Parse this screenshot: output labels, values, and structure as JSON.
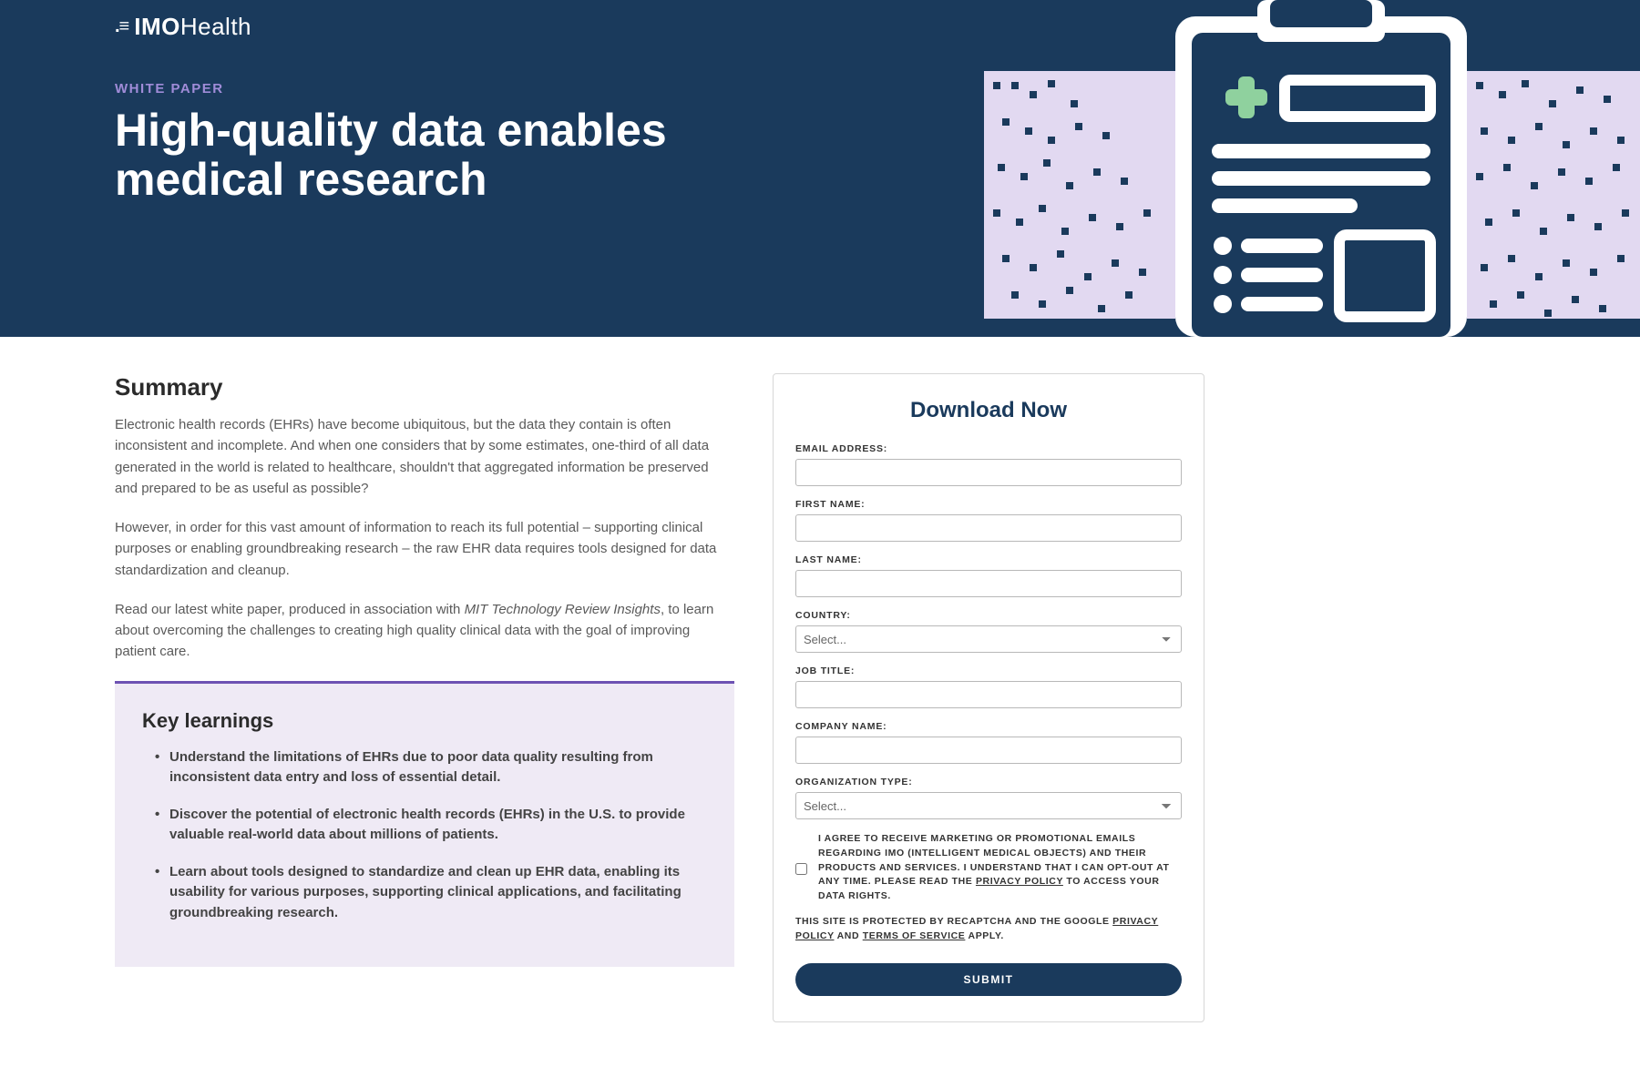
{
  "logo": {
    "mark": ".≡",
    "bold": "IMO",
    "light": "Health"
  },
  "eyebrow": "WHITE PAPER",
  "title": "High-quality data enables medical research",
  "summary": {
    "heading": "Summary",
    "p1": "Electronic health records (EHRs) have become ubiquitous, but the data they contain is often inconsistent and incomplete. And when one considers that by some estimates, one-third of all data generated in the world is related to healthcare, shouldn't that aggregated information be preserved and prepared to be as useful as possible?",
    "p2": "However, in order for this vast amount of information to reach its full potential – supporting clinical purposes or enabling groundbreaking research – the raw EHR data requires tools designed for data standardization and cleanup.",
    "p3_a": "Read our latest white paper, produced in association with ",
    "p3_em": "MIT Technology Review Insights",
    "p3_b": ", to learn about overcoming the challenges to creating high quality clinical data with the goal of improving patient care."
  },
  "key": {
    "heading": "Key learnings",
    "items": [
      "Understand the limitations of EHRs due to poor data quality resulting from inconsistent data entry and loss of essential detail.",
      "Discover the potential of electronic health records (EHRs) in the U.S. to provide valuable real-world data about millions of patients.",
      "Learn about tools designed to standardize and clean up EHR data, enabling its usability for various purposes, supporting clinical applications, and facilitating groundbreaking research."
    ]
  },
  "form": {
    "title": "Download Now",
    "email_label": "EMAIL ADDRESS:",
    "first_label": "FIRST NAME:",
    "last_label": "LAST NAME:",
    "country_label": "COUNTRY:",
    "country_placeholder": "Select...",
    "job_label": "JOB TITLE:",
    "company_label": "COMPANY NAME:",
    "org_label": "ORGANIZATION TYPE:",
    "org_placeholder": "Select...",
    "consent_a": "I AGREE TO RECEIVE MARKETING OR PROMOTIONAL EMAILS REGARDING IMO (INTELLIGENT MEDICAL OBJECTS) AND THEIR PRODUCTS AND SERVICES. I UNDERSTAND THAT I CAN OPT-OUT AT ANY TIME. PLEASE READ THE ",
    "consent_link": "PRIVACY POLICY",
    "consent_b": " TO ACCESS YOUR DATA RIGHTS.",
    "recaptcha_a": "THIS SITE IS PROTECTED BY RECAPTCHA AND THE GOOGLE ",
    "recaptcha_priv": "PRIVACY POLICY",
    "recaptcha_and": " AND ",
    "recaptcha_tos": "TERMS OF SERVICE",
    "recaptcha_b": " APPLY.",
    "submit": "SUBMIT"
  }
}
